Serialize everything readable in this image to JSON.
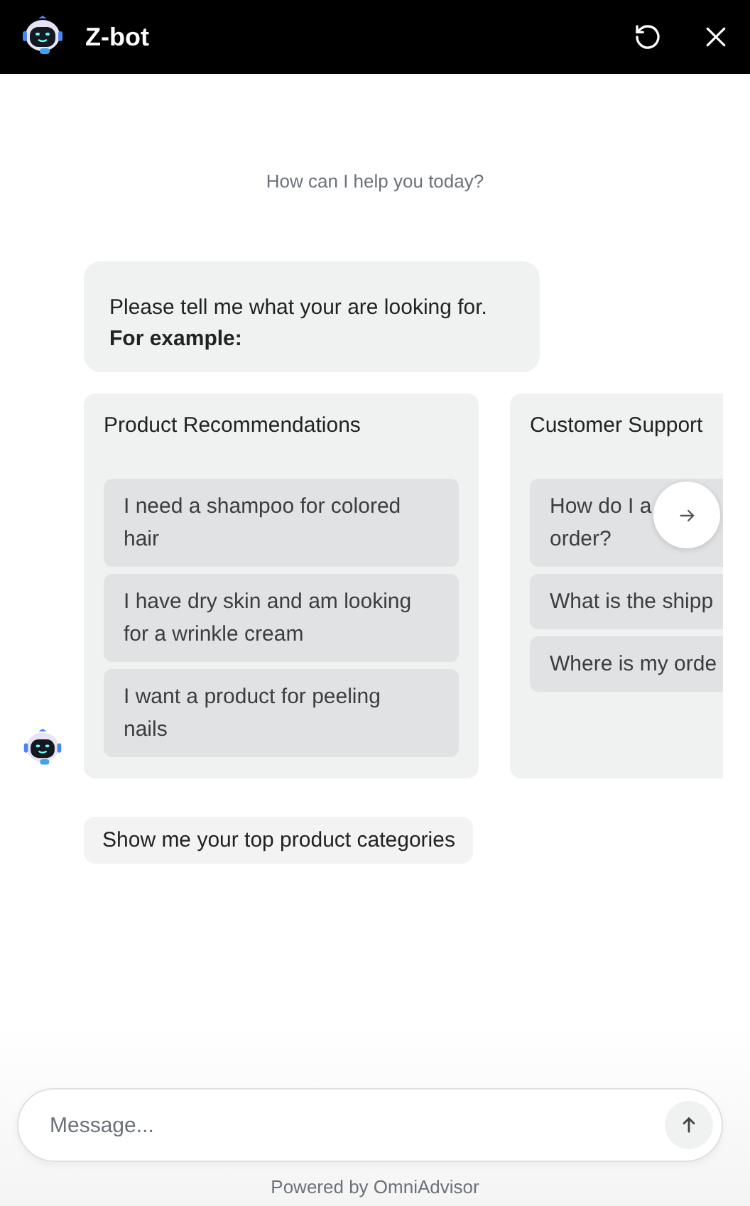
{
  "header": {
    "title": "Z-bot"
  },
  "greeting": "How can I help you today?",
  "bot_message": {
    "text": "Please tell me what your are looking for.",
    "emphasis": "For example:"
  },
  "cards": [
    {
      "title": "Product Recommendations",
      "items": [
        [
          "I need a shampoo for colored",
          "hair"
        ],
        [
          "I have dry skin and am looking",
          "for a wrinkle cream"
        ],
        [
          "I want a product for peeling",
          "nails"
        ]
      ]
    },
    {
      "title": "Customer Support",
      "items": [
        [
          "How do I a",
          "order?"
        ],
        [
          "What is the shipp"
        ],
        [
          "Where is my orde"
        ]
      ]
    }
  ],
  "suggestion": "Show me your top product categories",
  "composer": {
    "placeholder": "Message..."
  },
  "footer": "Powered by OmniAdvisor"
}
